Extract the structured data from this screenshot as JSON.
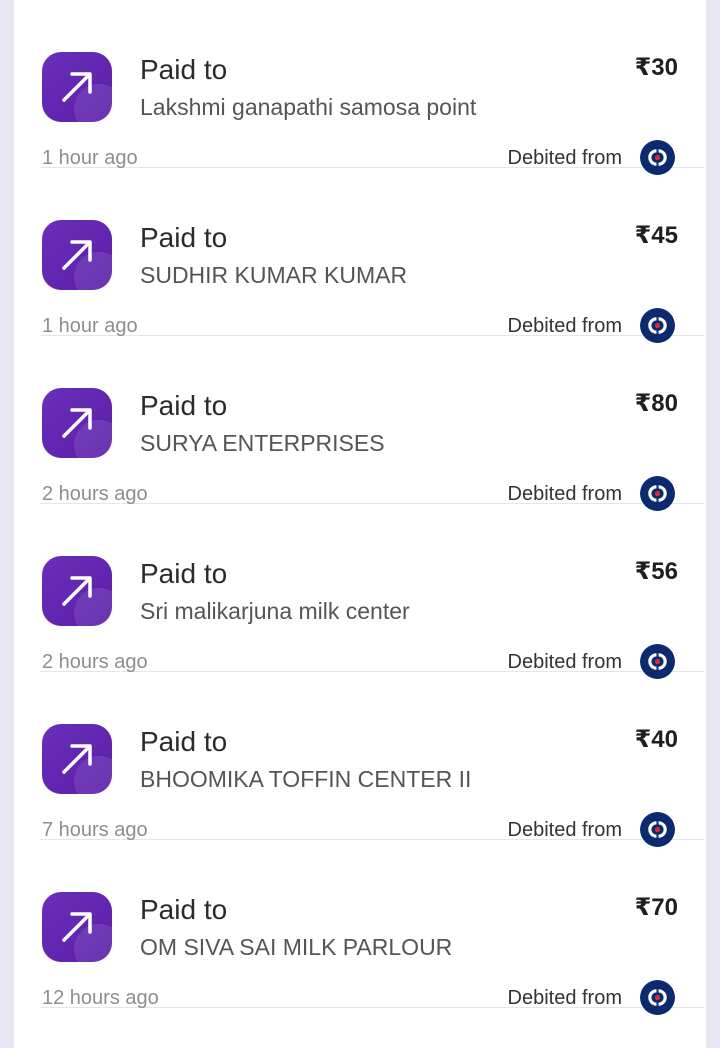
{
  "transactions": [
    {
      "label": "Paid to",
      "payee": "Lakshmi ganapathi samosa point",
      "amount": "₹30",
      "time": "1 hour ago",
      "debited_label": "Debited from",
      "icon": "arrow-up-right-icon",
      "bank_icon": "bank-logo-icon"
    },
    {
      "label": "Paid to",
      "payee": "SUDHIR KUMAR KUMAR",
      "amount": "₹45",
      "time": "1 hour ago",
      "debited_label": "Debited from",
      "icon": "arrow-up-right-icon",
      "bank_icon": "bank-logo-icon"
    },
    {
      "label": "Paid to",
      "payee": "SURYA ENTERPRISES",
      "amount": "₹80",
      "time": "2 hours ago",
      "debited_label": "Debited from",
      "icon": "arrow-up-right-icon",
      "bank_icon": "bank-logo-icon"
    },
    {
      "label": "Paid to",
      "payee": "Sri malikarjuna milk center",
      "amount": "₹56",
      "time": "2 hours ago",
      "debited_label": "Debited from",
      "icon": "arrow-up-right-icon",
      "bank_icon": "bank-logo-icon"
    },
    {
      "label": "Paid to",
      "payee": "BHOOMIKA TOFFIN CENTER II",
      "amount": "₹40",
      "time": "7 hours ago",
      "debited_label": "Debited from",
      "icon": "arrow-up-right-icon",
      "bank_icon": "bank-logo-icon"
    },
    {
      "label": "Paid to",
      "payee": "OM SIVA SAI MILK PARLOUR",
      "amount": "₹70",
      "time": "12 hours ago",
      "debited_label": "Debited from",
      "icon": "arrow-up-right-icon",
      "bank_icon": "bank-logo-icon"
    }
  ],
  "colors": {
    "accent": "#5f25ae",
    "bank_blue": "#0b2a6f",
    "bank_red": "#e3262e",
    "background": "#ebe6f5"
  }
}
